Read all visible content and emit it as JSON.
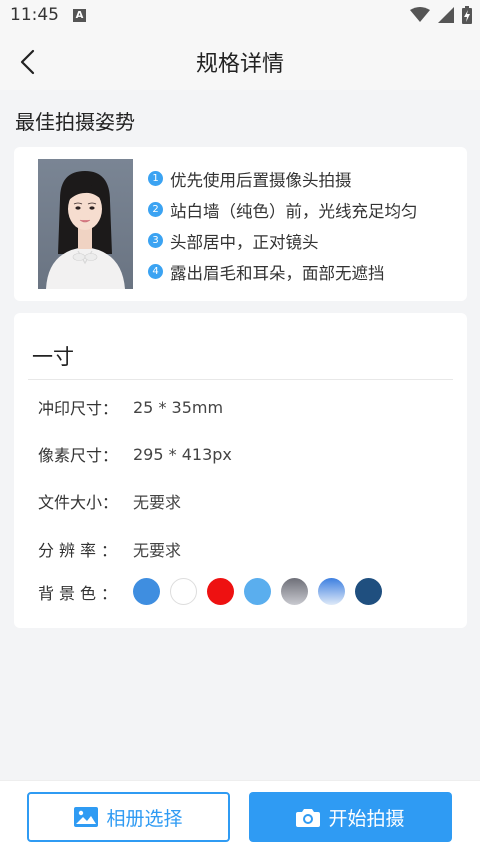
{
  "status": {
    "time": "11:45",
    "notif_letter": "A"
  },
  "nav": {
    "title": "规格详情"
  },
  "pose": {
    "section_title": "最佳拍摄姿势",
    "tips": [
      {
        "num": "1",
        "text": "优先使用后置摄像头拍摄"
      },
      {
        "num": "2",
        "text": "站白墙（纯色）前，光线充足均匀"
      },
      {
        "num": "3",
        "text": "头部居中，正对镜头"
      },
      {
        "num": "4",
        "text": "露出眉毛和耳朵，面部无遮挡"
      }
    ]
  },
  "spec": {
    "title": "一寸",
    "rows": {
      "print_size": {
        "label": "冲印尺寸：",
        "value": "25 * 35mm"
      },
      "pixel_size": {
        "label": "像素尺寸：",
        "value": "295 * 413px"
      },
      "file_size": {
        "label": "文件大小：",
        "value": "无要求"
      },
      "resolution": {
        "label": "分辨率：",
        "value": "无要求"
      },
      "background": {
        "label": "背景色："
      }
    },
    "bg_colors": [
      "#3f8ee0",
      "#ffffff",
      "#ee1111",
      "#5aaeee",
      "gradient-gray",
      "gradient-lightblue",
      "#1f4f7f"
    ]
  },
  "buttons": {
    "album_label": "相册选择",
    "shoot_label": "开始拍摄"
  },
  "accent_color": "#2f9bf3"
}
